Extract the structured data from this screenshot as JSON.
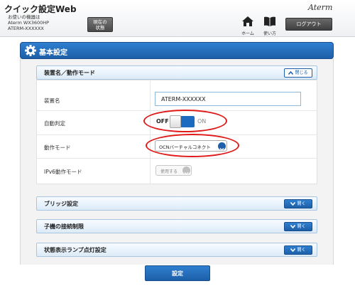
{
  "header": {
    "app_title": "クイック設定Web",
    "device_info": {
      "line1": "お使いの機器は",
      "line2": "Aterm WX3600HP",
      "line3": "ATERM-XXXXXX"
    },
    "status_button": {
      "line1": "現在の",
      "line2": "状態"
    },
    "brand": "Aterm",
    "nav": {
      "home_label": "ホーム",
      "manual_label": "使い方"
    },
    "logout_label": "ログアウト"
  },
  "section": {
    "title": "基本設定"
  },
  "accordions": {
    "device_mode": {
      "title": "装置名／動作モード",
      "button": "閉じる",
      "state": "expanded"
    },
    "bridge": {
      "title": "ブリッジ設定",
      "button": "開く",
      "state": "collapsed"
    },
    "child_limit": {
      "title": "子機の接続制限",
      "button": "開く",
      "state": "collapsed"
    },
    "lamp": {
      "title": "状態表示ランプ点灯設定",
      "button": "開く",
      "state": "collapsed"
    }
  },
  "settings": {
    "device_name": {
      "label": "装置名",
      "value": "ATERM-XXXXXX"
    },
    "auto_detect": {
      "label": "自動判定",
      "off_label": "OFF",
      "on_label": "ON",
      "state": "off"
    },
    "operation_mode": {
      "label": "動作モード",
      "value": "OCNバーチャルコネクト"
    },
    "ipv6_mode": {
      "label": "IPv6動作モード",
      "value": "使用する"
    }
  },
  "apply_label": "設定",
  "colors": {
    "accent": "#1d5fa8",
    "accent_light": "#2f7fd0",
    "annotation": "#e01919",
    "accordion_bg": "#dcebf8",
    "header_btn": "#4a4a4a"
  },
  "icons": [
    "home-icon",
    "book-icon",
    "gear-icon",
    "chevron-up-icon",
    "chevron-down-icon"
  ]
}
